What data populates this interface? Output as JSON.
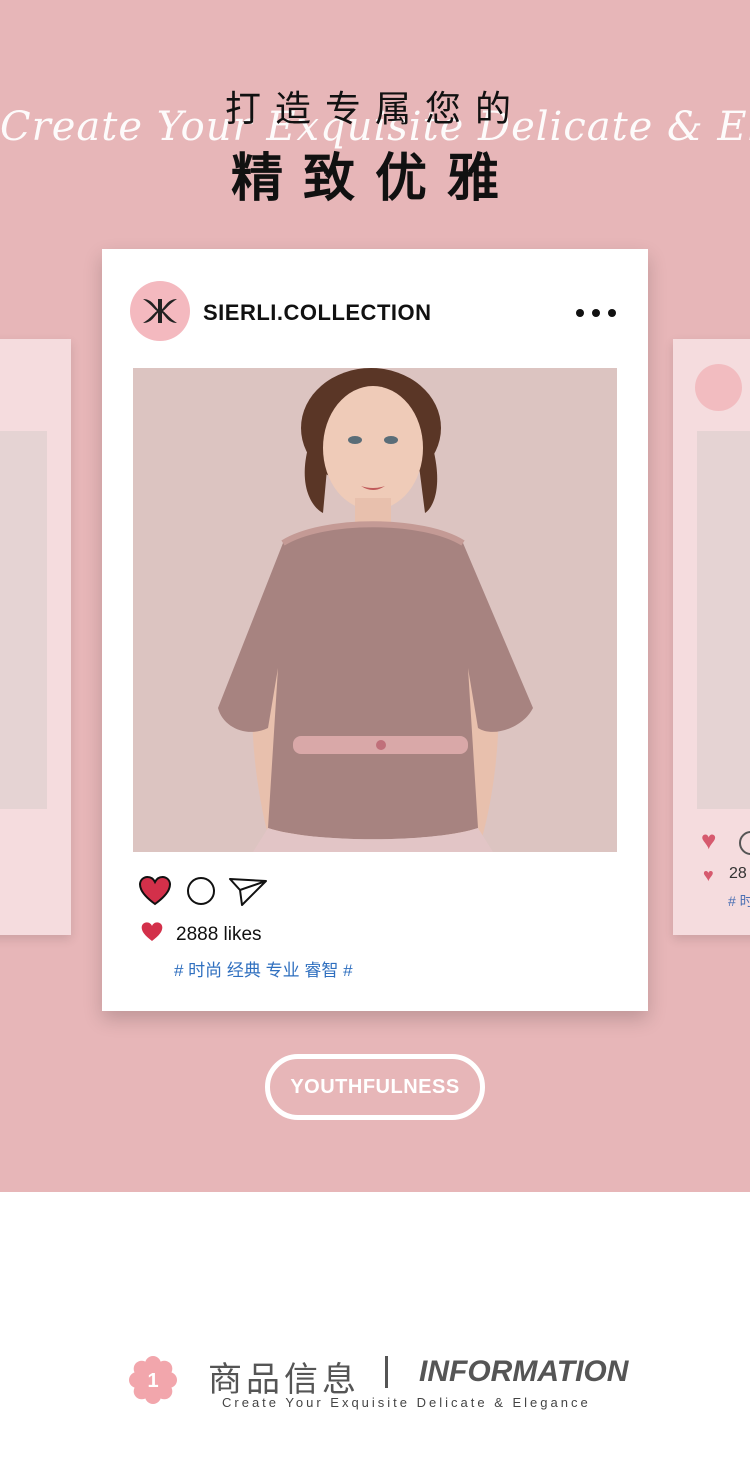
{
  "header": {
    "title_line_1": "打造专属您的",
    "title_line_2": "精致优雅",
    "script_text": "Create Your Exquisite Delicate & Elegance"
  },
  "post": {
    "account_name": "SIERLI.COLLECTION",
    "likes_text": "2888 likes",
    "hashtags": "# 时尚 经典 专业 睿智 #",
    "icons": [
      "heart-icon",
      "comment-icon",
      "share-icon",
      "more-icon"
    ]
  },
  "side_card_right": {
    "likes_text": "28",
    "hashtag_text": "# 时"
  },
  "badge": {
    "label": "YOUTHFULNESS"
  },
  "section": {
    "number": "1",
    "title_cn": "商品信息",
    "title_en": "INFORMATION",
    "subtitle": "Create Your Exquisite Delicate & Elegance"
  },
  "colors": {
    "background_pink": "#e7b6b8",
    "side_card_pink": "#f5dcde",
    "heart_red": "#d3304a",
    "hashtag_blue": "#2f6fbf",
    "section_gray": "#555555"
  }
}
